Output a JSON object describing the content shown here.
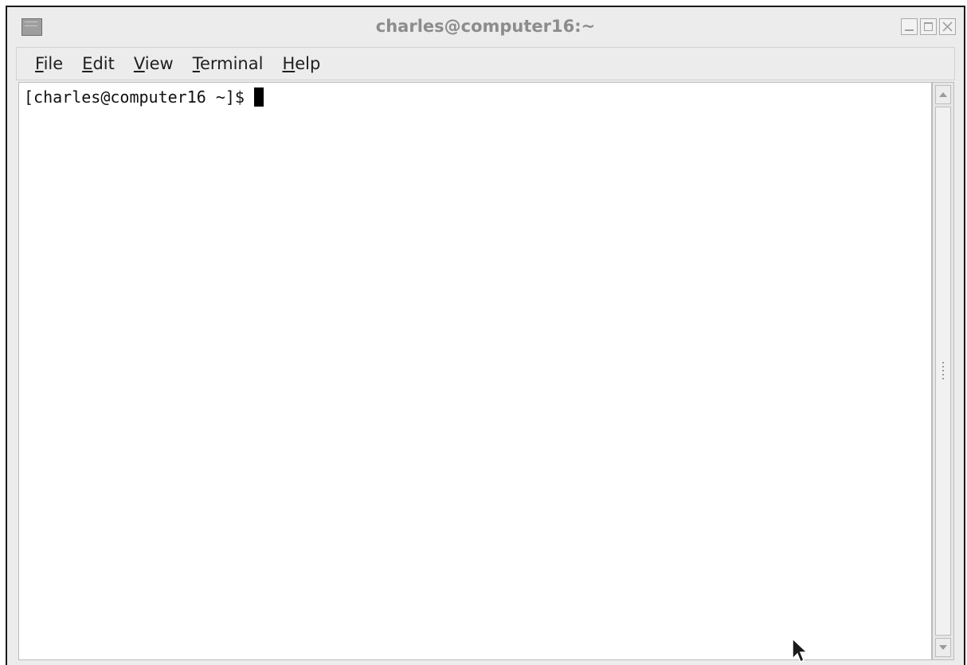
{
  "window": {
    "title": "charles@computer16:~"
  },
  "menu": [
    {
      "mnemonic": "F",
      "rest": "ile"
    },
    {
      "mnemonic": "E",
      "rest": "dit"
    },
    {
      "mnemonic": "V",
      "rest": "iew"
    },
    {
      "mnemonic": "T",
      "rest": "erminal"
    },
    {
      "mnemonic": "H",
      "rest": "elp"
    }
  ],
  "terminal": {
    "prompt": "[charles@computer16 ~]$ "
  },
  "icons": {
    "app": "terminal-app-icon",
    "minimize": "minimize-icon",
    "maximize": "maximize-icon",
    "close": "close-icon",
    "scroll_up": "arrow-up-icon",
    "scroll_down": "arrow-down-icon",
    "pointer": "mouse-pointer-icon"
  },
  "colors": {
    "title_text": "#8c8c8c",
    "window_chrome": "#ececec",
    "terminal_bg": "#ffffff",
    "terminal_fg": "#111111"
  }
}
